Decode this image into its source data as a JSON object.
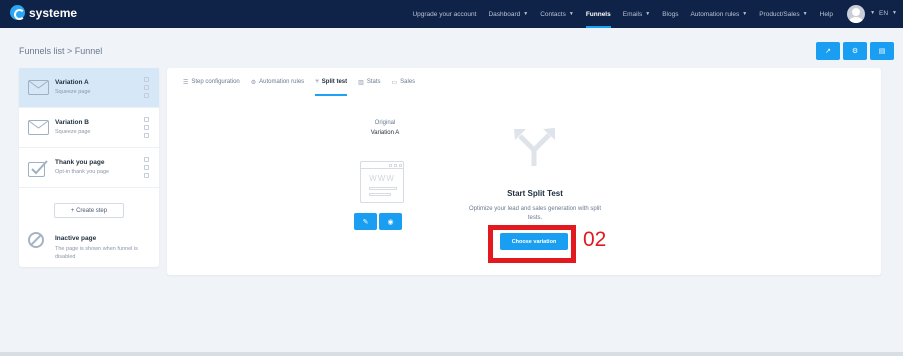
{
  "brand": {
    "name": "systeme"
  },
  "nav": {
    "items": [
      {
        "label": "Upgrade your account"
      },
      {
        "label": "Dashboard",
        "dropdown": true
      },
      {
        "label": "Contacts",
        "dropdown": true
      },
      {
        "label": "Funnels",
        "active": true
      },
      {
        "label": "Emails",
        "dropdown": true
      },
      {
        "label": "Blogs"
      },
      {
        "label": "Automation rules",
        "dropdown": true
      },
      {
        "label": "Product/Sales",
        "dropdown": true
      },
      {
        "label": "Help"
      }
    ],
    "language": "EN"
  },
  "header": {
    "breadcrumb": "Funnels list > Funnel"
  },
  "sidebar": {
    "steps": [
      {
        "title": "Variation A",
        "subtitle": "Squeeze page",
        "selected": true,
        "icon": "envelope-icon"
      },
      {
        "title": "Variation B",
        "subtitle": "Squeeze page",
        "icon": "envelope-icon"
      },
      {
        "title": "Thank you page",
        "subtitle": "Opt-in thank you page",
        "icon": "checkbox-icon"
      }
    ],
    "create_step": "+ Create step",
    "inactive": {
      "title": "Inactive page",
      "description": "The page is shown when funnel is disabled"
    }
  },
  "tabs": [
    {
      "label": "Step configuration",
      "icon": "list-icon"
    },
    {
      "label": "Automation rules",
      "icon": "gears-icon"
    },
    {
      "label": "Split test",
      "icon": "split-icon",
      "active": true
    },
    {
      "label": "Stats",
      "icon": "bar-chart-icon"
    },
    {
      "label": "Sales",
      "icon": "money-icon"
    }
  ],
  "split": {
    "original_label": "Original",
    "original_variation": "Variation A",
    "www_text": "WWW",
    "title": "Start Split Test",
    "description": "Optimize your lead and sales generation with split tests.",
    "choose_button": "Choose variation"
  },
  "annotation": {
    "number": "02",
    "color": "#e2191f"
  },
  "colors": {
    "accent": "#1a9ef2",
    "topbar": "#0f2247"
  }
}
